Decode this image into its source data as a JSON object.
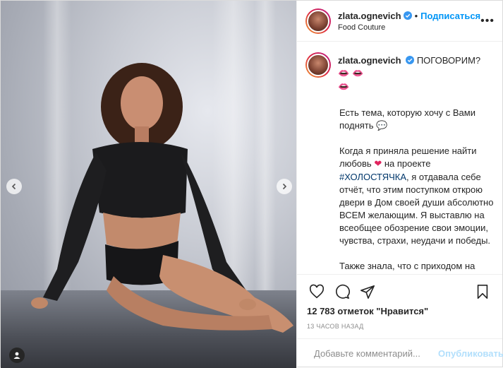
{
  "post": {
    "author": "zlata.ognevich",
    "follow_label": "Подписаться",
    "location": "Food Couture",
    "more_label": "•••",
    "caption": {
      "first_line": "ПОГОВОРИМ?",
      "lips_emoji": "👄 👄",
      "lips_emoji2": "👄",
      "p1": "Есть тема, которую хочу с Вами поднять 💬",
      "p2_a": "Когда я приняла решение найти любовь ",
      "p2_heart": "❤",
      "p2_b": " на проекте ",
      "p2_hashtag": "#ХОЛОСТЯЧКА",
      "p2_c": ", я отдавала себе отчёт, что этим поступком открою двери в Дом своей души абсолютно ВСЕМ желающим. Я выставлю на всеобщее обозрение свои эмоции, чувства, страхи, неудачи и победы.",
      "p3": "Также знала, что с приходом на проект, я расскажу свой путь, в котором кто-то увидит повод для хейта, а кто-то- повод для мотивации"
    },
    "likes": "12 783 отметок \"Нравится\"",
    "timestamp": "13 ЧАСОВ НАЗАД",
    "comment": {
      "placeholder": "Добавьте комментарий...",
      "publish_label": "Опубликовать"
    }
  },
  "colors": {
    "accent": "#0095f6",
    "hashtag": "#00376b",
    "publish_disabled": "#b2dffc",
    "like_heart": "#ed4956"
  },
  "icons": [
    "verified-icon",
    "chevron-left-icon",
    "chevron-right-icon",
    "user-tag-icon",
    "heart-icon",
    "comment-icon",
    "share-icon",
    "bookmark-icon",
    "emoji-icon"
  ]
}
